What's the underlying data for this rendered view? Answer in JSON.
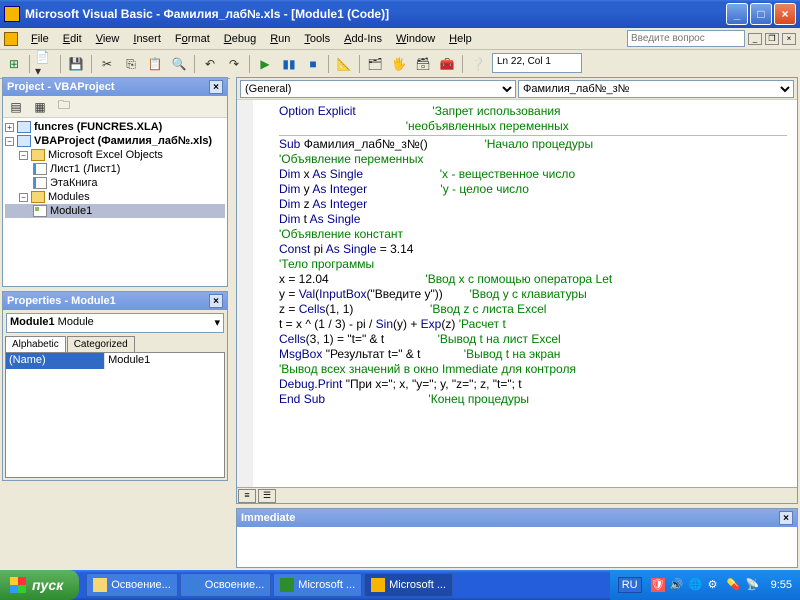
{
  "window": {
    "title": "Microsoft Visual Basic - Фамилия_лаб№.xls - [Module1 (Code)]"
  },
  "menu": {
    "items": [
      "File",
      "Edit",
      "View",
      "Insert",
      "Format",
      "Debug",
      "Run",
      "Tools",
      "Add-Ins",
      "Window",
      "Help"
    ],
    "ask_placeholder": "Введите вопрос"
  },
  "status_pos": "Ln 22, Col 1",
  "project_pane": {
    "title": "Project - VBAProject",
    "tree": {
      "funcres": "funcres (FUNCRES.XLA)",
      "vbaproject": "VBAProject (Фамилия_лаб№.xls)",
      "excel_objects": "Microsoft Excel Objects",
      "sheet1": "Лист1 (Лист1)",
      "thisworkbook": "ЭтаКнига",
      "modules": "Modules",
      "module1": "Module1"
    }
  },
  "properties_pane": {
    "title": "Properties - Module1",
    "object": "Module1 Module",
    "tabs": {
      "alphabetic": "Alphabetic",
      "categorized": "Categorized"
    },
    "rows": {
      "name_key": "(Name)",
      "name_val": "Module1"
    }
  },
  "code": {
    "combo_left": "(General)",
    "combo_right": "Фамилия_лаб№_з№",
    "lines": [
      {
        "t": "Option Explicit",
        "c": "'Запрет использования"
      },
      {
        "t": "",
        "c": "'необъявленных переменных"
      },
      {
        "sep": true
      },
      {
        "t": "Sub Фамилия_лаб№_з№()",
        "c": "'Начало процедуры"
      },
      {
        "t": "",
        "c": "'Объявление переменных",
        "conly": true
      },
      {
        "t": "Dim x As Single",
        "c": "'x - вещественное число"
      },
      {
        "t": "Dim y As Integer",
        "c": "'y - целое число"
      },
      {
        "t": "Dim z As Integer",
        "c": ""
      },
      {
        "t": "Dim t As Single",
        "c": ""
      },
      {
        "t": "",
        "c": "'Объявление констант",
        "conly": true
      },
      {
        "t": "Const pi As Single = 3.14",
        "c": ""
      },
      {
        "t": "",
        "c": "'Тело программы",
        "conly": true
      },
      {
        "t": "x = 12.04",
        "c": "'Ввод x с помощью оператора Let"
      },
      {
        "t": "y = Val(InputBox(\"Введите y\"))",
        "c": "'Ввод y с клавиатуры"
      },
      {
        "t": "z = Cells(1, 1)",
        "c": "'Ввод z с листа Excel"
      },
      {
        "t": "t = x ^ (1 / 3) - pi / Sin(y) + Exp(z)",
        "c": "'Расчет t"
      },
      {
        "t": "Cells(3, 1) = \"t=\" & t",
        "c": "'Вывод t на лист Excel"
      },
      {
        "t": "MsgBox \"Результат t=\" & t",
        "c": "'Вывод t на экран"
      },
      {
        "t": "",
        "c": "'Вывод всех значений в окно Immediate для контроля",
        "conly": true
      },
      {
        "t": "Debug.Print \"При x=\"; x, \"y=\"; y, \"z=\"; z, \"t=\"; t",
        "c": ""
      },
      {
        "t": "End Sub",
        "c": "'Конец процедуры"
      }
    ]
  },
  "immediate": {
    "title": "Immediate"
  },
  "taskbar": {
    "start": "пуск",
    "buttons": [
      "Освоение...",
      "Освоение...",
      "Microsoft ...",
      "Microsoft ..."
    ],
    "lang": "RU",
    "clock": "9:55"
  }
}
